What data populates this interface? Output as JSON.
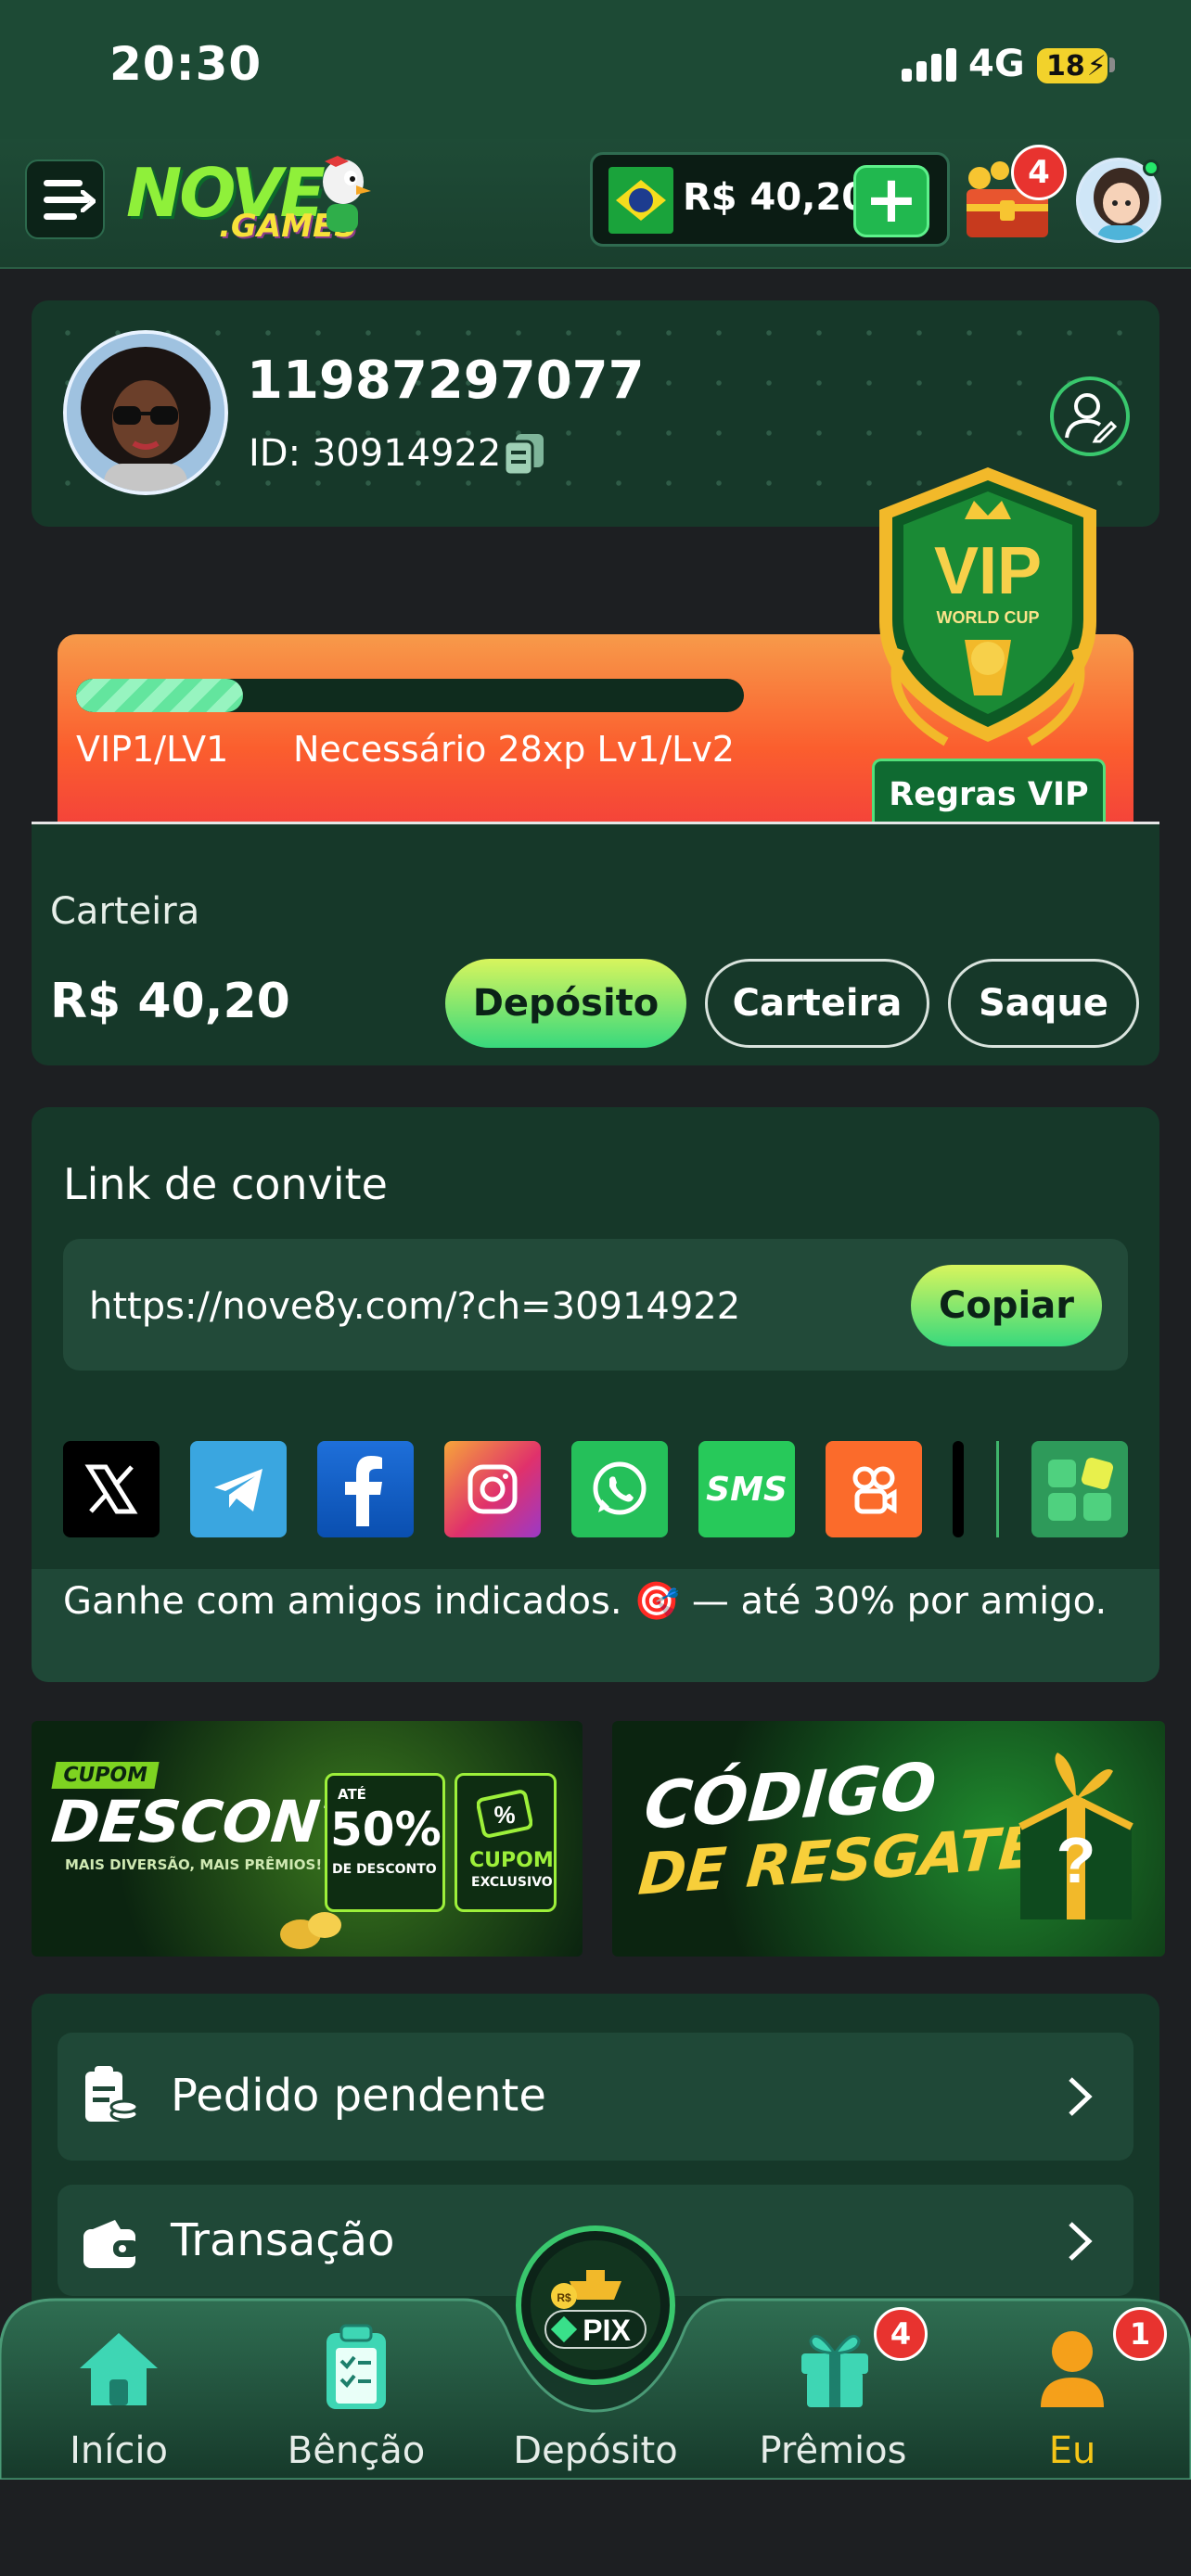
{
  "status_bar": {
    "time": "20:30",
    "network": "4G",
    "battery": "18"
  },
  "header": {
    "logo_main": "NOVE",
    "logo_sub": ".GAMES",
    "balance": "R$ 40,20",
    "add_symbol": "+",
    "chest_badge": "4"
  },
  "profile": {
    "username": "11987297077",
    "id_label": "ID: 30914922"
  },
  "vip": {
    "level": "VIP1/LV1",
    "requirement": "Necessário 28xp Lv1/Lv2",
    "rules_label": "Regras VIP",
    "progress_fraction": 0.25,
    "shield_title": "VIP",
    "shield_subtitle": "WORLD CUP"
  },
  "wallet": {
    "label": "Carteira",
    "value": "R$ 40,20",
    "deposit_label": "Depósito",
    "wallet_label": "Carteira",
    "withdraw_label": "Saque"
  },
  "invite": {
    "title": "Link de convite",
    "link": "https://nove8y.com/?ch=30914922",
    "copy_label": "Copiar",
    "note": "Ganhe com amigos indicados. 🎯 — até 30% por amigo.",
    "social_icons": [
      "x-icon",
      "telegram-icon",
      "facebook-icon",
      "instagram-icon",
      "whatsapp-icon",
      "sms-icon",
      "kwai-icon",
      "tiktok-icon",
      "more-apps-icon"
    ],
    "sms_text": "SMS"
  },
  "banners": {
    "left": {
      "tag": "CUPOM",
      "title": "DESCONTO",
      "sub": "MAIS DIVERSÃO, MAIS PRÊMIOS!",
      "ate": "ATÉ",
      "percent": "50%",
      "of": "DE DESCONTO",
      "cupom": "CUPOM",
      "exclusivo": "EXCLUSIVO"
    },
    "right": {
      "line1": "CÓDIGO",
      "line2": "DE RESGATE"
    }
  },
  "menu": {
    "pending": "Pedido pendente",
    "transaction": "Transação"
  },
  "tabbar": {
    "home": "Início",
    "blessing": "Bênção",
    "deposit": "Depósito",
    "prizes": "Prêmios",
    "me": "Eu",
    "prizes_badge": "4",
    "me_badge": "1",
    "pix_text": "PIX",
    "rs_text": "R$"
  },
  "colors": {
    "accent_green": "#38d97d",
    "accent_yellow": "#d8f55d",
    "active_tab": "#f5c518",
    "badge_red": "#e8332f"
  }
}
